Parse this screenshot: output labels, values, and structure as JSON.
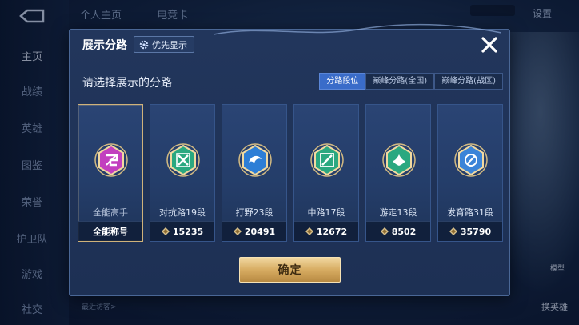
{
  "background": {
    "top_tabs": [
      "个人主页",
      "电竞卡"
    ],
    "settings_label": "设置",
    "nav": [
      "主页",
      "战绩",
      "英雄",
      "图鉴",
      "荣誉",
      "护卫队",
      "游戏",
      "社交"
    ],
    "recent_visitors": "最近访客>",
    "switch_hero": "换英雄",
    "model_label": "模型"
  },
  "dialog": {
    "title": "展示分路",
    "priority_button": "优先显示",
    "prompt": "请选择展示的分路",
    "tabs": [
      {
        "label": "分路段位",
        "active": true
      },
      {
        "label": "巅峰分路(全国)",
        "active": false
      },
      {
        "label": "巅峰分路(战区)",
        "active": false
      }
    ],
    "cards": [
      {
        "name": "全能高手",
        "footer": "全能称号",
        "emblem": "all-round-emblem-icon",
        "color": "#c23fbf",
        "selected": true
      },
      {
        "name": "对抗路19段",
        "footer": "15235",
        "emblem": "clash-lane-emblem-icon",
        "color": "#2aa880",
        "selected": false
      },
      {
        "name": "打野23段",
        "footer": "20491",
        "emblem": "jungle-emblem-icon",
        "color": "#2d7ed6",
        "selected": false
      },
      {
        "name": "中路17段",
        "footer": "12672",
        "emblem": "mid-lane-emblem-icon",
        "color": "#2aa880",
        "selected": false
      },
      {
        "name": "游走13段",
        "footer": "8502",
        "emblem": "roam-emblem-icon",
        "color": "#2aa880",
        "selected": false
      },
      {
        "name": "发育路31段",
        "footer": "35790",
        "emblem": "farm-lane-emblem-icon",
        "color": "#3b84d8",
        "selected": false
      }
    ],
    "confirm_button": "确定"
  }
}
